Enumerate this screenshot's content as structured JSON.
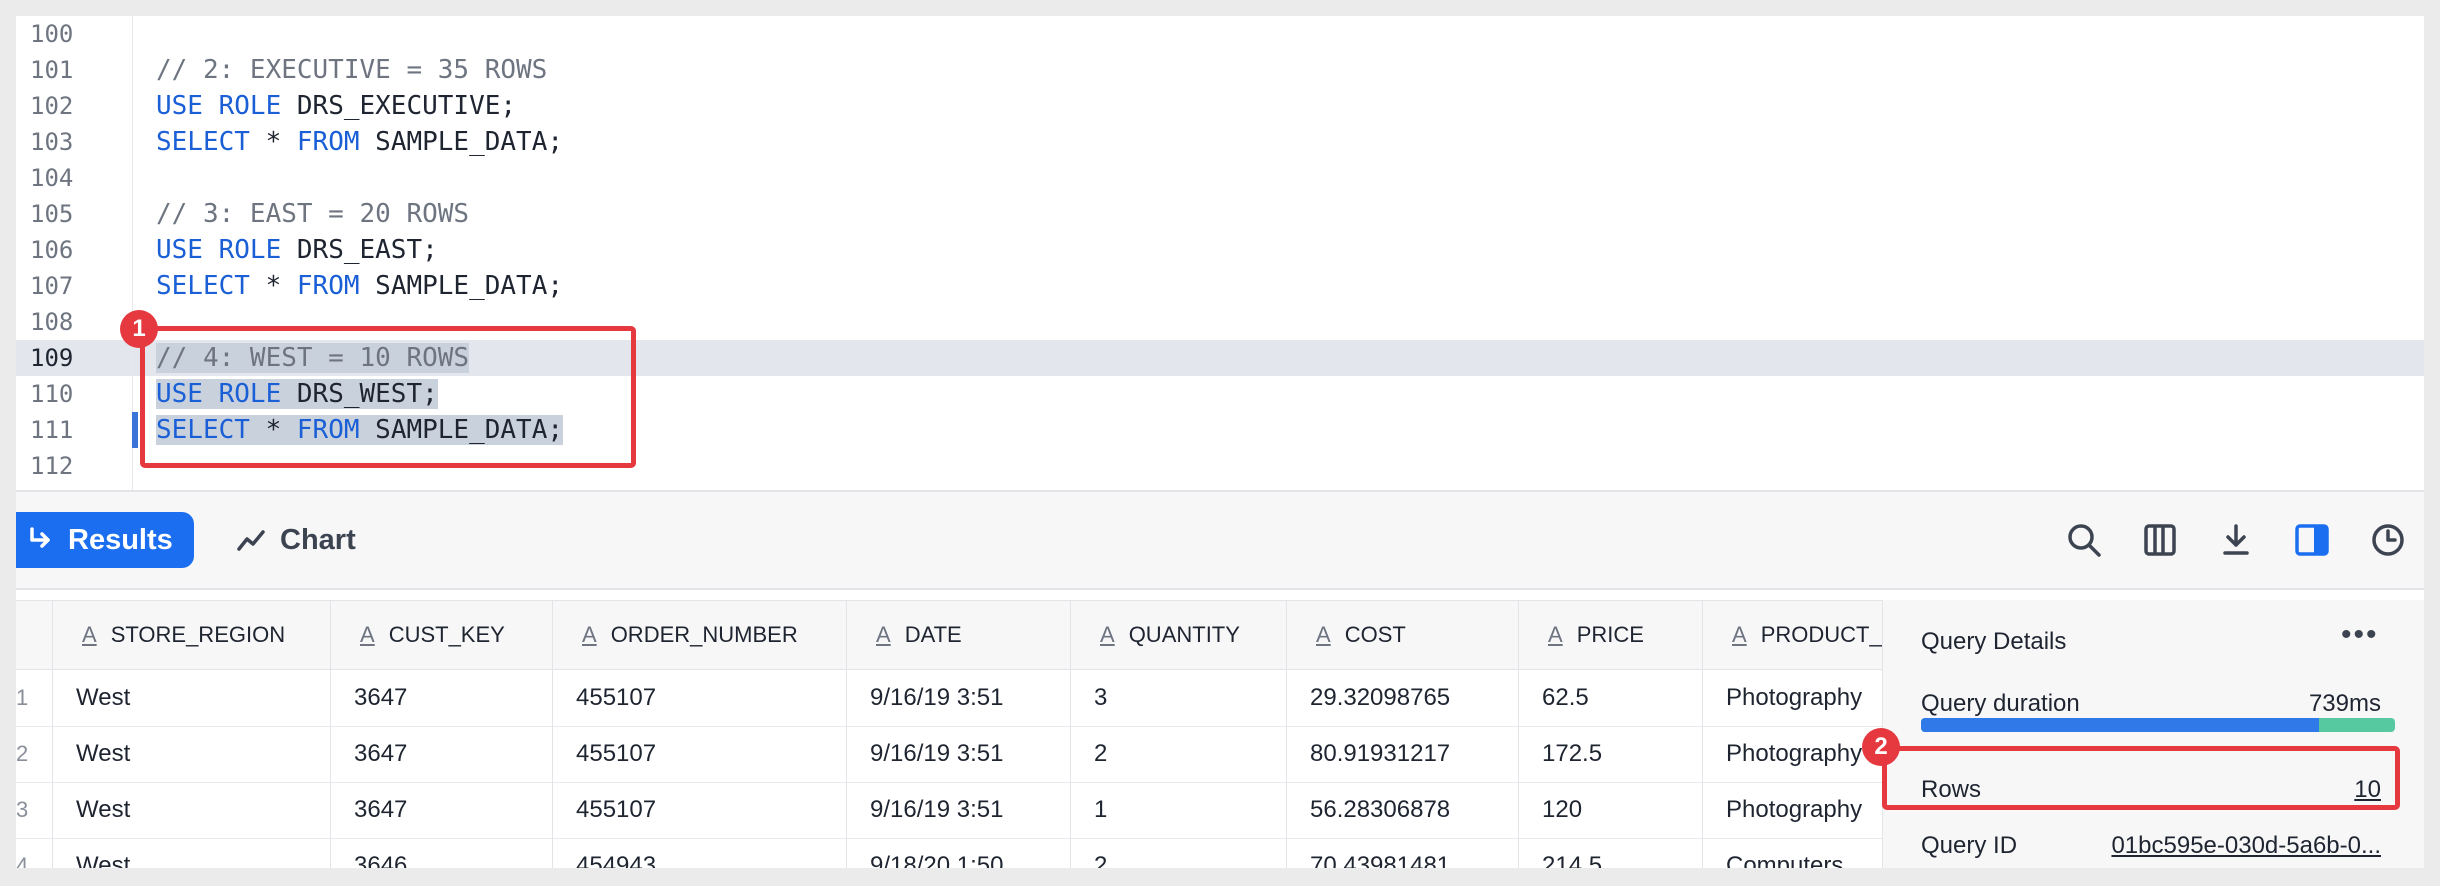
{
  "editor": {
    "lines": [
      {
        "num": "100",
        "tokens": []
      },
      {
        "num": "101",
        "tokens": [
          {
            "t": "// 2: EXECUTIVE = 35 ROWS",
            "c": "cm"
          }
        ]
      },
      {
        "num": "102",
        "tokens": [
          {
            "t": "USE ROLE",
            "c": "kw"
          },
          {
            "t": " DRS_EXECUTIVE;",
            "c": ""
          }
        ]
      },
      {
        "num": "103",
        "tokens": [
          {
            "t": "SELECT",
            "c": "kw"
          },
          {
            "t": " * ",
            "c": ""
          },
          {
            "t": "FROM",
            "c": "kw"
          },
          {
            "t": " SAMPLE_DATA;",
            "c": ""
          }
        ]
      },
      {
        "num": "104",
        "tokens": []
      },
      {
        "num": "105",
        "tokens": [
          {
            "t": "// 3: EAST = 20 ROWS",
            "c": "cm"
          }
        ]
      },
      {
        "num": "106",
        "tokens": [
          {
            "t": "USE ROLE",
            "c": "kw"
          },
          {
            "t": " DRS_EAST;",
            "c": ""
          }
        ]
      },
      {
        "num": "107",
        "tokens": [
          {
            "t": "SELECT",
            "c": "kw"
          },
          {
            "t": " * ",
            "c": ""
          },
          {
            "t": "FROM",
            "c": "kw"
          },
          {
            "t": " SAMPLE_DATA;",
            "c": ""
          }
        ]
      },
      {
        "num": "108",
        "tokens": []
      },
      {
        "num": "109",
        "tokens": [
          {
            "t": "// 4: WEST = 10 ROWS",
            "c": "cm"
          }
        ],
        "active": true,
        "highlight": true
      },
      {
        "num": "110",
        "tokens": [
          {
            "t": "USE ROLE",
            "c": "kw"
          },
          {
            "t": " DRS_WEST;",
            "c": ""
          }
        ],
        "selected": true
      },
      {
        "num": "111",
        "tokens": [
          {
            "t": "SELECT",
            "c": "kw"
          },
          {
            "t": " * ",
            "c": ""
          },
          {
            "t": "FROM",
            "c": "kw"
          },
          {
            "t": " SAMPLE_DATA;",
            "c": ""
          }
        ],
        "selected": true
      },
      {
        "num": "112",
        "tokens": []
      }
    ]
  },
  "annotations": {
    "badge1": "1",
    "badge2": "2"
  },
  "toolbar": {
    "results_label": "Results",
    "chart_label": "Chart",
    "icons": [
      "search-icon",
      "columns-icon",
      "download-icon",
      "side-panel-icon",
      "history-icon"
    ]
  },
  "table": {
    "columns": [
      "STORE_REGION",
      "CUST_KEY",
      "ORDER_NUMBER",
      "DATE",
      "QUANTITY",
      "COST",
      "PRICE",
      "PRODUCT_TYPE"
    ],
    "rows": [
      {
        "num": "1",
        "cells": [
          "West",
          "3647",
          "455107",
          "9/16/19 3:51",
          "3",
          "29.32098765",
          "62.5",
          "Photography"
        ]
      },
      {
        "num": "2",
        "cells": [
          "West",
          "3647",
          "455107",
          "9/16/19 3:51",
          "2",
          "80.91931217",
          "172.5",
          "Photography"
        ]
      },
      {
        "num": "3",
        "cells": [
          "West",
          "3647",
          "455107",
          "9/16/19 3:51",
          "1",
          "56.28306878",
          "120",
          "Photography"
        ]
      },
      {
        "num": "4",
        "cells": [
          "West",
          "3646",
          "454943",
          "9/18/20 1:50",
          "2",
          "70.43981481",
          "214.5",
          "Computers"
        ]
      }
    ]
  },
  "panel": {
    "title": "Query Details",
    "menu": "•••",
    "duration_label": "Query duration",
    "duration_value": "739ms",
    "duration_split": 0.84,
    "rows_label": "Rows",
    "rows_value": "10",
    "query_id_label": "Query ID",
    "query_id_value": "01bc595e-030d-5a6b-0..."
  },
  "colors": {
    "accent": "#1b6ef0",
    "annotation": "#e5383f",
    "bar_primary": "#2f7ae8",
    "bar_secondary": "#57c9a0"
  }
}
